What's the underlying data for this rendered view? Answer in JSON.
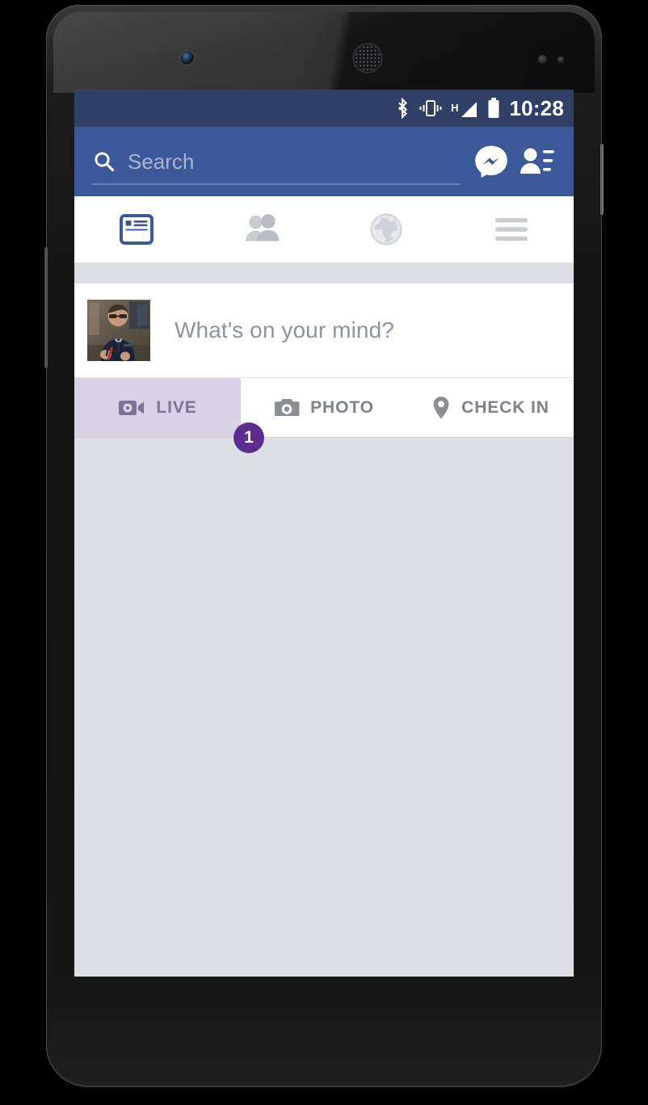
{
  "device": {
    "name": "android-smartphone",
    "hardware": {
      "front_camera": "camera-icon",
      "earpiece": "speaker-grille-icon",
      "proximity_sensor": "sensor-icon",
      "light_sensor": "sensor-icon",
      "power_button": "power-button",
      "volume_button": "volume-rocker"
    }
  },
  "status_bar": {
    "clock": "10:28",
    "background": "#2f3f66",
    "icons": [
      {
        "name": "bluetooth-icon",
        "label": "Bluetooth"
      },
      {
        "name": "vibrate-icon",
        "label": "Vibrate mode"
      },
      {
        "name": "signal-icon",
        "label": "H"
      },
      {
        "name": "battery-icon",
        "label": "Battery"
      }
    ],
    "signal_network_label": "H"
  },
  "toolbar": {
    "background": "#3b5998",
    "search": {
      "icon": "search-icon",
      "value": "",
      "placeholder": "Search"
    },
    "actions": [
      {
        "name": "messenger-icon",
        "label": "Messenger"
      },
      {
        "name": "friend-requests-icon",
        "label": "Friend Requests"
      }
    ]
  },
  "nav_tabs": {
    "active_index": 0,
    "active_color": "#3b5998",
    "inactive_color": "#c9ccd1",
    "items": [
      {
        "name": "tab-news-feed",
        "icon": "news-feed-icon",
        "label": "News Feed",
        "active": true
      },
      {
        "name": "tab-friends",
        "icon": "friends-icon",
        "label": "Friends",
        "active": false
      },
      {
        "name": "tab-globe",
        "icon": "globe-icon",
        "label": "Notifications",
        "active": false
      },
      {
        "name": "tab-menu",
        "icon": "hamburger-menu-icon",
        "label": "Menu",
        "active": false
      }
    ]
  },
  "composer": {
    "avatar": "profile-photo",
    "placeholder": "What's on your mind?"
  },
  "action_row": {
    "buttons": [
      {
        "name": "live-button",
        "icon": "video-camera-icon",
        "label": "LIVE",
        "highlighted": true
      },
      {
        "name": "photo-button",
        "icon": "camera-icon",
        "label": "PHOTO",
        "highlighted": false
      },
      {
        "name": "check-in-button",
        "icon": "location-pin-icon",
        "label": "CHECK IN",
        "highlighted": false
      }
    ],
    "highlight_color": "#d9d1e6"
  },
  "annotation": {
    "badge_number": "1",
    "badge_color": "#5b2d8e",
    "badge_text_color": "#ffffff"
  },
  "feed": {
    "background": "#dcdfe4",
    "content": ""
  }
}
